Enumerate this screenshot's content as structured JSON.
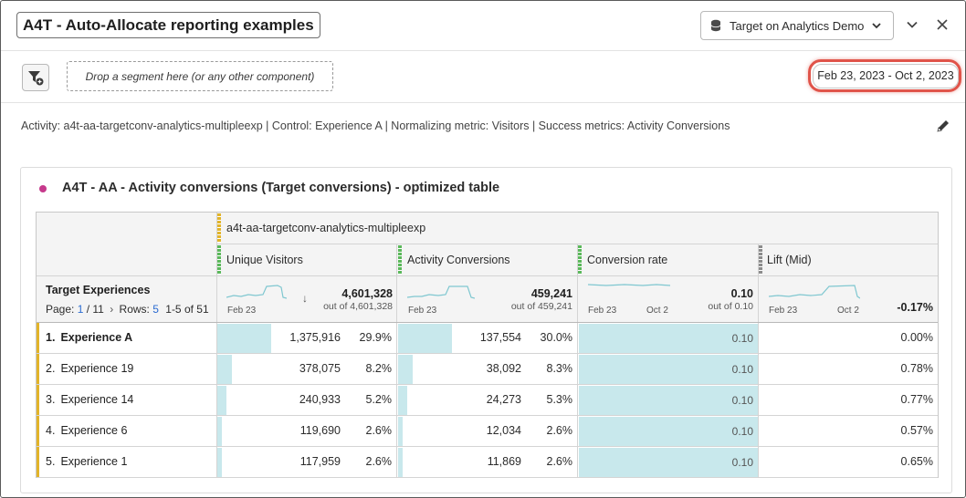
{
  "header": {
    "title": "A4T - Auto-Allocate reporting examples",
    "report_suite": "Target on Analytics Demo",
    "icons": [
      "database-icon",
      "chevron-down-icon",
      "collapse-chevron-icon",
      "close-icon"
    ]
  },
  "segment_bar": {
    "filter_icon": "add-segment-filter-icon",
    "drop_placeholder": "Drop a segment here (or any other component)",
    "date_range": "Feb 23, 2023 - Oct 2, 2023"
  },
  "activity_description": "Activity: a4t-aa-targetconv-analytics-multipleexp | Control: Experience A | Normalizing metric: Visitors | Success metrics: Activity Conversions",
  "panel": {
    "title": "A4T - AA - Activity conversions (Target conversions) - optimized table",
    "dot_color": "#c6398c"
  },
  "table": {
    "segment_header": "a4t-aa-targetconv-analytics-multipleexp",
    "dimension_header": "Target Experiences",
    "pager": {
      "page_label": "Page:",
      "page": "1",
      "page_total": "/ 11",
      "rows_label": "Rows:",
      "rows": "5",
      "range": "1-5 of 51"
    },
    "columns": [
      {
        "label": "Unique Visitors",
        "total": "4,601,328",
        "total_sub": "out of 4,601,328",
        "spark_start": "Feb 23",
        "spark_end": "",
        "bar_color": "#5bb85b",
        "sorted": true
      },
      {
        "label": "Activity Conversions",
        "total": "459,241",
        "total_sub": "out of 459,241",
        "spark_start": "Feb 23",
        "spark_end": "",
        "bar_color": "#5bb85b",
        "sorted": false
      },
      {
        "label": "Conversion rate",
        "total": "0.10",
        "total_sub": "out of 0.10",
        "spark_start": "Feb 23",
        "spark_end": "Oct 2",
        "bar_color": "#5bb85b",
        "sorted": false
      },
      {
        "label": "Lift (Mid)",
        "total": "-0.17%",
        "total_sub": "",
        "spark_start": "Feb 23",
        "spark_end": "Oct 2",
        "bar_color": "#8c8c8c",
        "sorted": false
      }
    ],
    "rows": [
      {
        "num": "1.",
        "name": "Experience A",
        "visitors": "1,375,916",
        "visitors_pct": "29.9%",
        "visitors_share": 0.299,
        "conversions": "137,554",
        "conversions_pct": "30.0%",
        "conversions_share": 0.3,
        "rate": "0.10",
        "lift": "0.00%",
        "bold": true
      },
      {
        "num": "2.",
        "name": "Experience 19",
        "visitors": "378,075",
        "visitors_pct": "8.2%",
        "visitors_share": 0.082,
        "conversions": "38,092",
        "conversions_pct": "8.3%",
        "conversions_share": 0.083,
        "rate": "0.10",
        "lift": "0.78%",
        "bold": false
      },
      {
        "num": "3.",
        "name": "Experience 14",
        "visitors": "240,933",
        "visitors_pct": "5.2%",
        "visitors_share": 0.052,
        "conversions": "24,273",
        "conversions_pct": "5.3%",
        "conversions_share": 0.053,
        "rate": "0.10",
        "lift": "0.77%",
        "bold": false
      },
      {
        "num": "4.",
        "name": "Experience 6",
        "visitors": "119,690",
        "visitors_pct": "2.6%",
        "visitors_share": 0.026,
        "conversions": "12,034",
        "conversions_pct": "2.6%",
        "conversions_share": 0.026,
        "rate": "0.10",
        "lift": "0.57%",
        "bold": false
      },
      {
        "num": "5.",
        "name": "Experience 1",
        "visitors": "117,959",
        "visitors_pct": "2.6%",
        "visitors_share": 0.026,
        "conversions": "11,869",
        "conversions_pct": "2.6%",
        "conversions_share": 0.026,
        "rate": "0.10",
        "lift": "0.65%",
        "bold": false
      }
    ]
  },
  "colors": {
    "bar_fill": "#c8e8ec",
    "date_highlight": "#e0544a",
    "segment_accent": "#e2b42a",
    "link_blue": "#2b6bd1"
  }
}
